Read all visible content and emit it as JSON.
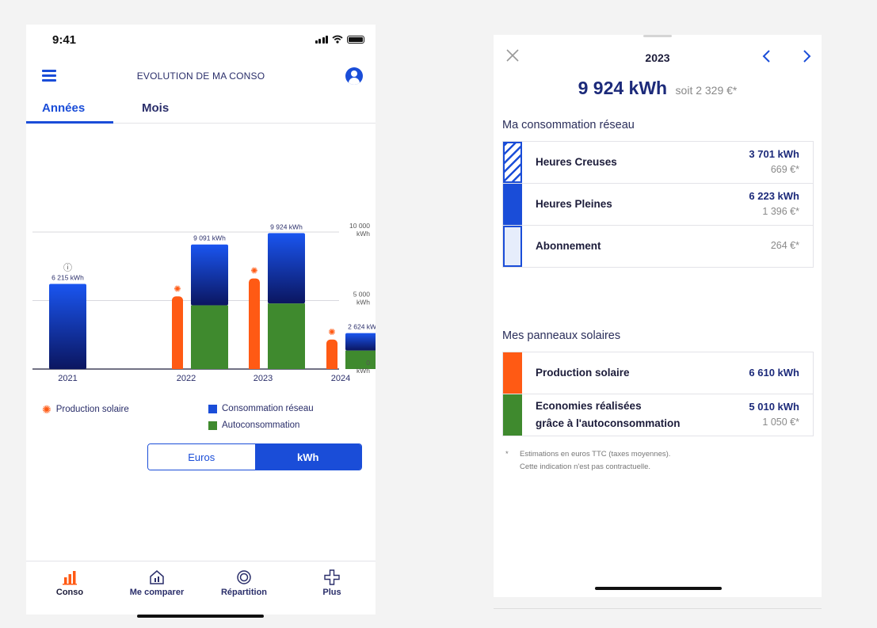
{
  "left_screen": {
    "status_bar": {
      "time": "9:41"
    },
    "header": {
      "title": "EVOLUTION DE MA CONSO"
    },
    "tabs": [
      {
        "label": "Années",
        "active": true
      },
      {
        "label": "Mois",
        "active": false
      }
    ],
    "info_glyph": "ⓘ",
    "chart_data": {
      "type": "bar",
      "categories": [
        "2021",
        "2022",
        "2023",
        "2024"
      ],
      "series": [
        {
          "name": "Production solaire",
          "values": [
            null,
            5300,
            6610,
            2150
          ],
          "color": "#ff5a14"
        },
        {
          "name": "Autoconsommation",
          "values": [
            null,
            4650,
            4790,
            1350
          ],
          "color": "#3f8a2e"
        },
        {
          "name": "Consommation réseau",
          "values": [
            6215,
            4441,
            5134,
            1274
          ],
          "color": "#1a4dd8"
        }
      ],
      "total_labels": [
        "6 215 kWh",
        "9 091 kWh",
        "9 924 kWh",
        "2 624 kWh"
      ],
      "y_ticks": [
        {
          "value": 0,
          "label": "0 kWh"
        },
        {
          "value": 5000,
          "label": "5 000 kWh"
        },
        {
          "value": 10000,
          "label": "10 000 kWh"
        }
      ],
      "ylim": [
        0,
        10000
      ],
      "legend": {
        "solar": "Production solaire",
        "grid": "Consommation réseau",
        "self": "Autoconsommation"
      }
    },
    "unit_toggle": {
      "euros": "Euros",
      "kwh": "kWh",
      "selected": "kWh"
    },
    "bottom_nav": [
      {
        "label": "Conso",
        "icon": "bar-chart-icon",
        "active": true
      },
      {
        "label": "Me comparer",
        "icon": "house-compare-icon",
        "active": false
      },
      {
        "label": "Répartition",
        "icon": "donut-icon",
        "active": false
      },
      {
        "label": "Plus",
        "icon": "plus-icon",
        "active": false
      }
    ],
    "colors": {
      "accent": "#1a4dd8",
      "solar": "#ff5a14",
      "self": "#3f8a2e",
      "grid_dark": "#0b1660"
    }
  },
  "right_screen": {
    "year": "2023",
    "total": {
      "kwh": "9 924 kWh",
      "euros": "soit 2 329 €*"
    },
    "reseau": {
      "title": "Ma consommation réseau",
      "rows": [
        {
          "label": "Heures Creuses",
          "kwh": "3 701 kWh",
          "euros": "669 €*"
        },
        {
          "label": "Heures Pleines",
          "kwh": "6 223 kWh",
          "euros": "1 396 €*"
        },
        {
          "label": "Abonnement",
          "kwh": "",
          "euros": "264 €*"
        }
      ]
    },
    "solaire": {
      "title": "Mes panneaux solaires",
      "rows": [
        {
          "label": "Production solaire",
          "kwh": "6 610 kWh",
          "euros": ""
        },
        {
          "label_line1": "Economies réalisées",
          "label_line2": "grâce à l'autoconsommation",
          "kwh": "5 010 kWh",
          "euros": "1 050 €*"
        }
      ]
    },
    "footnote": {
      "star": "*",
      "line1": "Estimations en euros TTC (taxes moyennes).",
      "line2": "Cette indication n'est pas contractuelle."
    }
  }
}
